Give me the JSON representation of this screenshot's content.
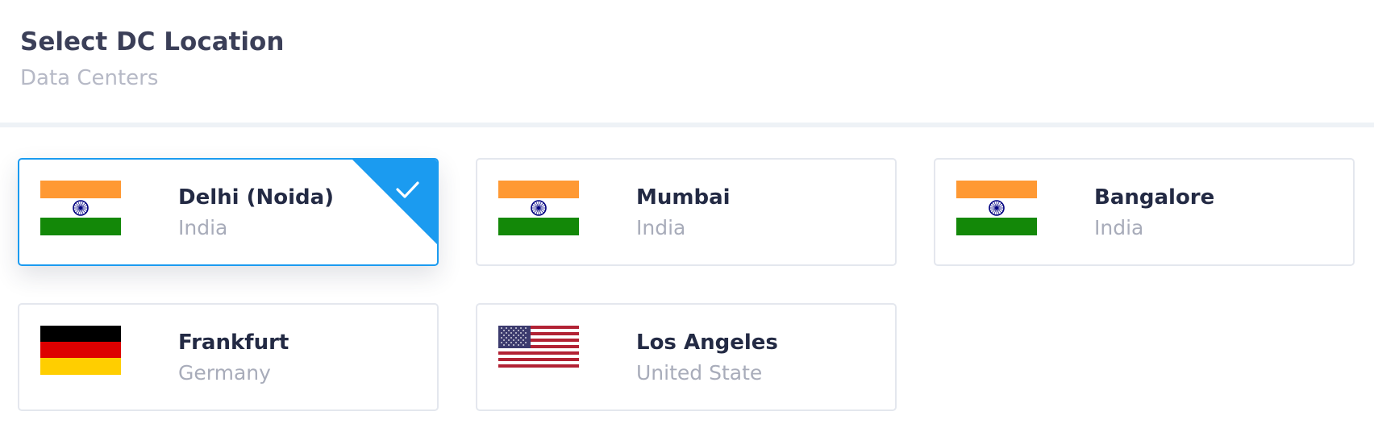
{
  "header": {
    "title": "Select DC Location",
    "subtitle": "Data Centers"
  },
  "locations": [
    {
      "city": "Delhi (Noida)",
      "country": "India",
      "flag": "india-flag-icon",
      "selected": true
    },
    {
      "city": "Mumbai",
      "country": "India",
      "flag": "india-flag-icon",
      "selected": false
    },
    {
      "city": "Bangalore",
      "country": "India",
      "flag": "india-flag-icon",
      "selected": false
    },
    {
      "city": "Frankfurt",
      "country": "Germany",
      "flag": "germany-flag-icon",
      "selected": false
    },
    {
      "city": "Los Angeles",
      "country": "United State",
      "flag": "usa-flag-icon",
      "selected": false
    }
  ],
  "colors": {
    "accent": "#1b9bf0",
    "title": "#3b3f58",
    "subtitle": "#b6b9c6",
    "card_border": "#e4e7ee"
  }
}
